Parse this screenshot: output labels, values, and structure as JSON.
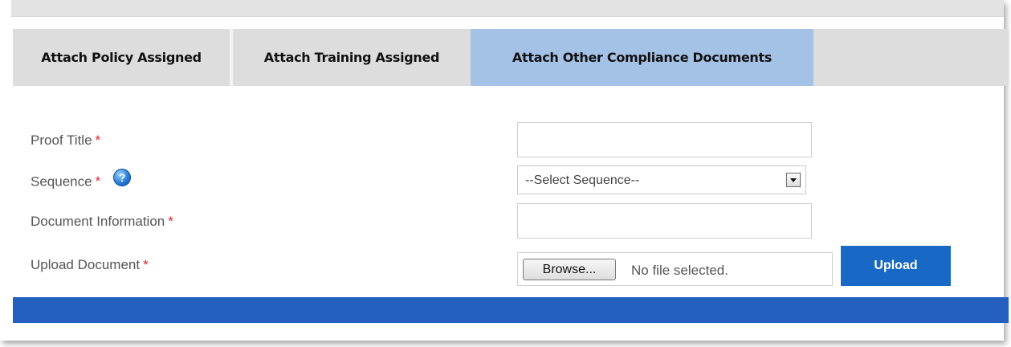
{
  "tabs": [
    {
      "label": "Attach Policy Assigned"
    },
    {
      "label": "Attach Training Assigned"
    },
    {
      "label": "Attach Other Compliance Documents",
      "active": true
    }
  ],
  "form": {
    "proof_title": {
      "label": "Proof Title",
      "required_mark": "*",
      "value": ""
    },
    "sequence": {
      "label": "Sequence",
      "required_mark": "*",
      "help_icon": "help-question-icon",
      "help_glyph": "?",
      "selected": "--Select Sequence--"
    },
    "document_information": {
      "label": "Document Information",
      "required_mark": "*",
      "value": ""
    },
    "upload_document": {
      "label": "Upload Document",
      "required_mark": "*",
      "browse_label": "Browse...",
      "file_status": "No file selected.",
      "upload_label": "Upload"
    }
  },
  "colors": {
    "active_tab": "#a4c2e6",
    "inactive_tab": "#dddddd",
    "upload_button": "#1869c5",
    "footer_bar": "#2460bf",
    "required": "#e8202a"
  }
}
